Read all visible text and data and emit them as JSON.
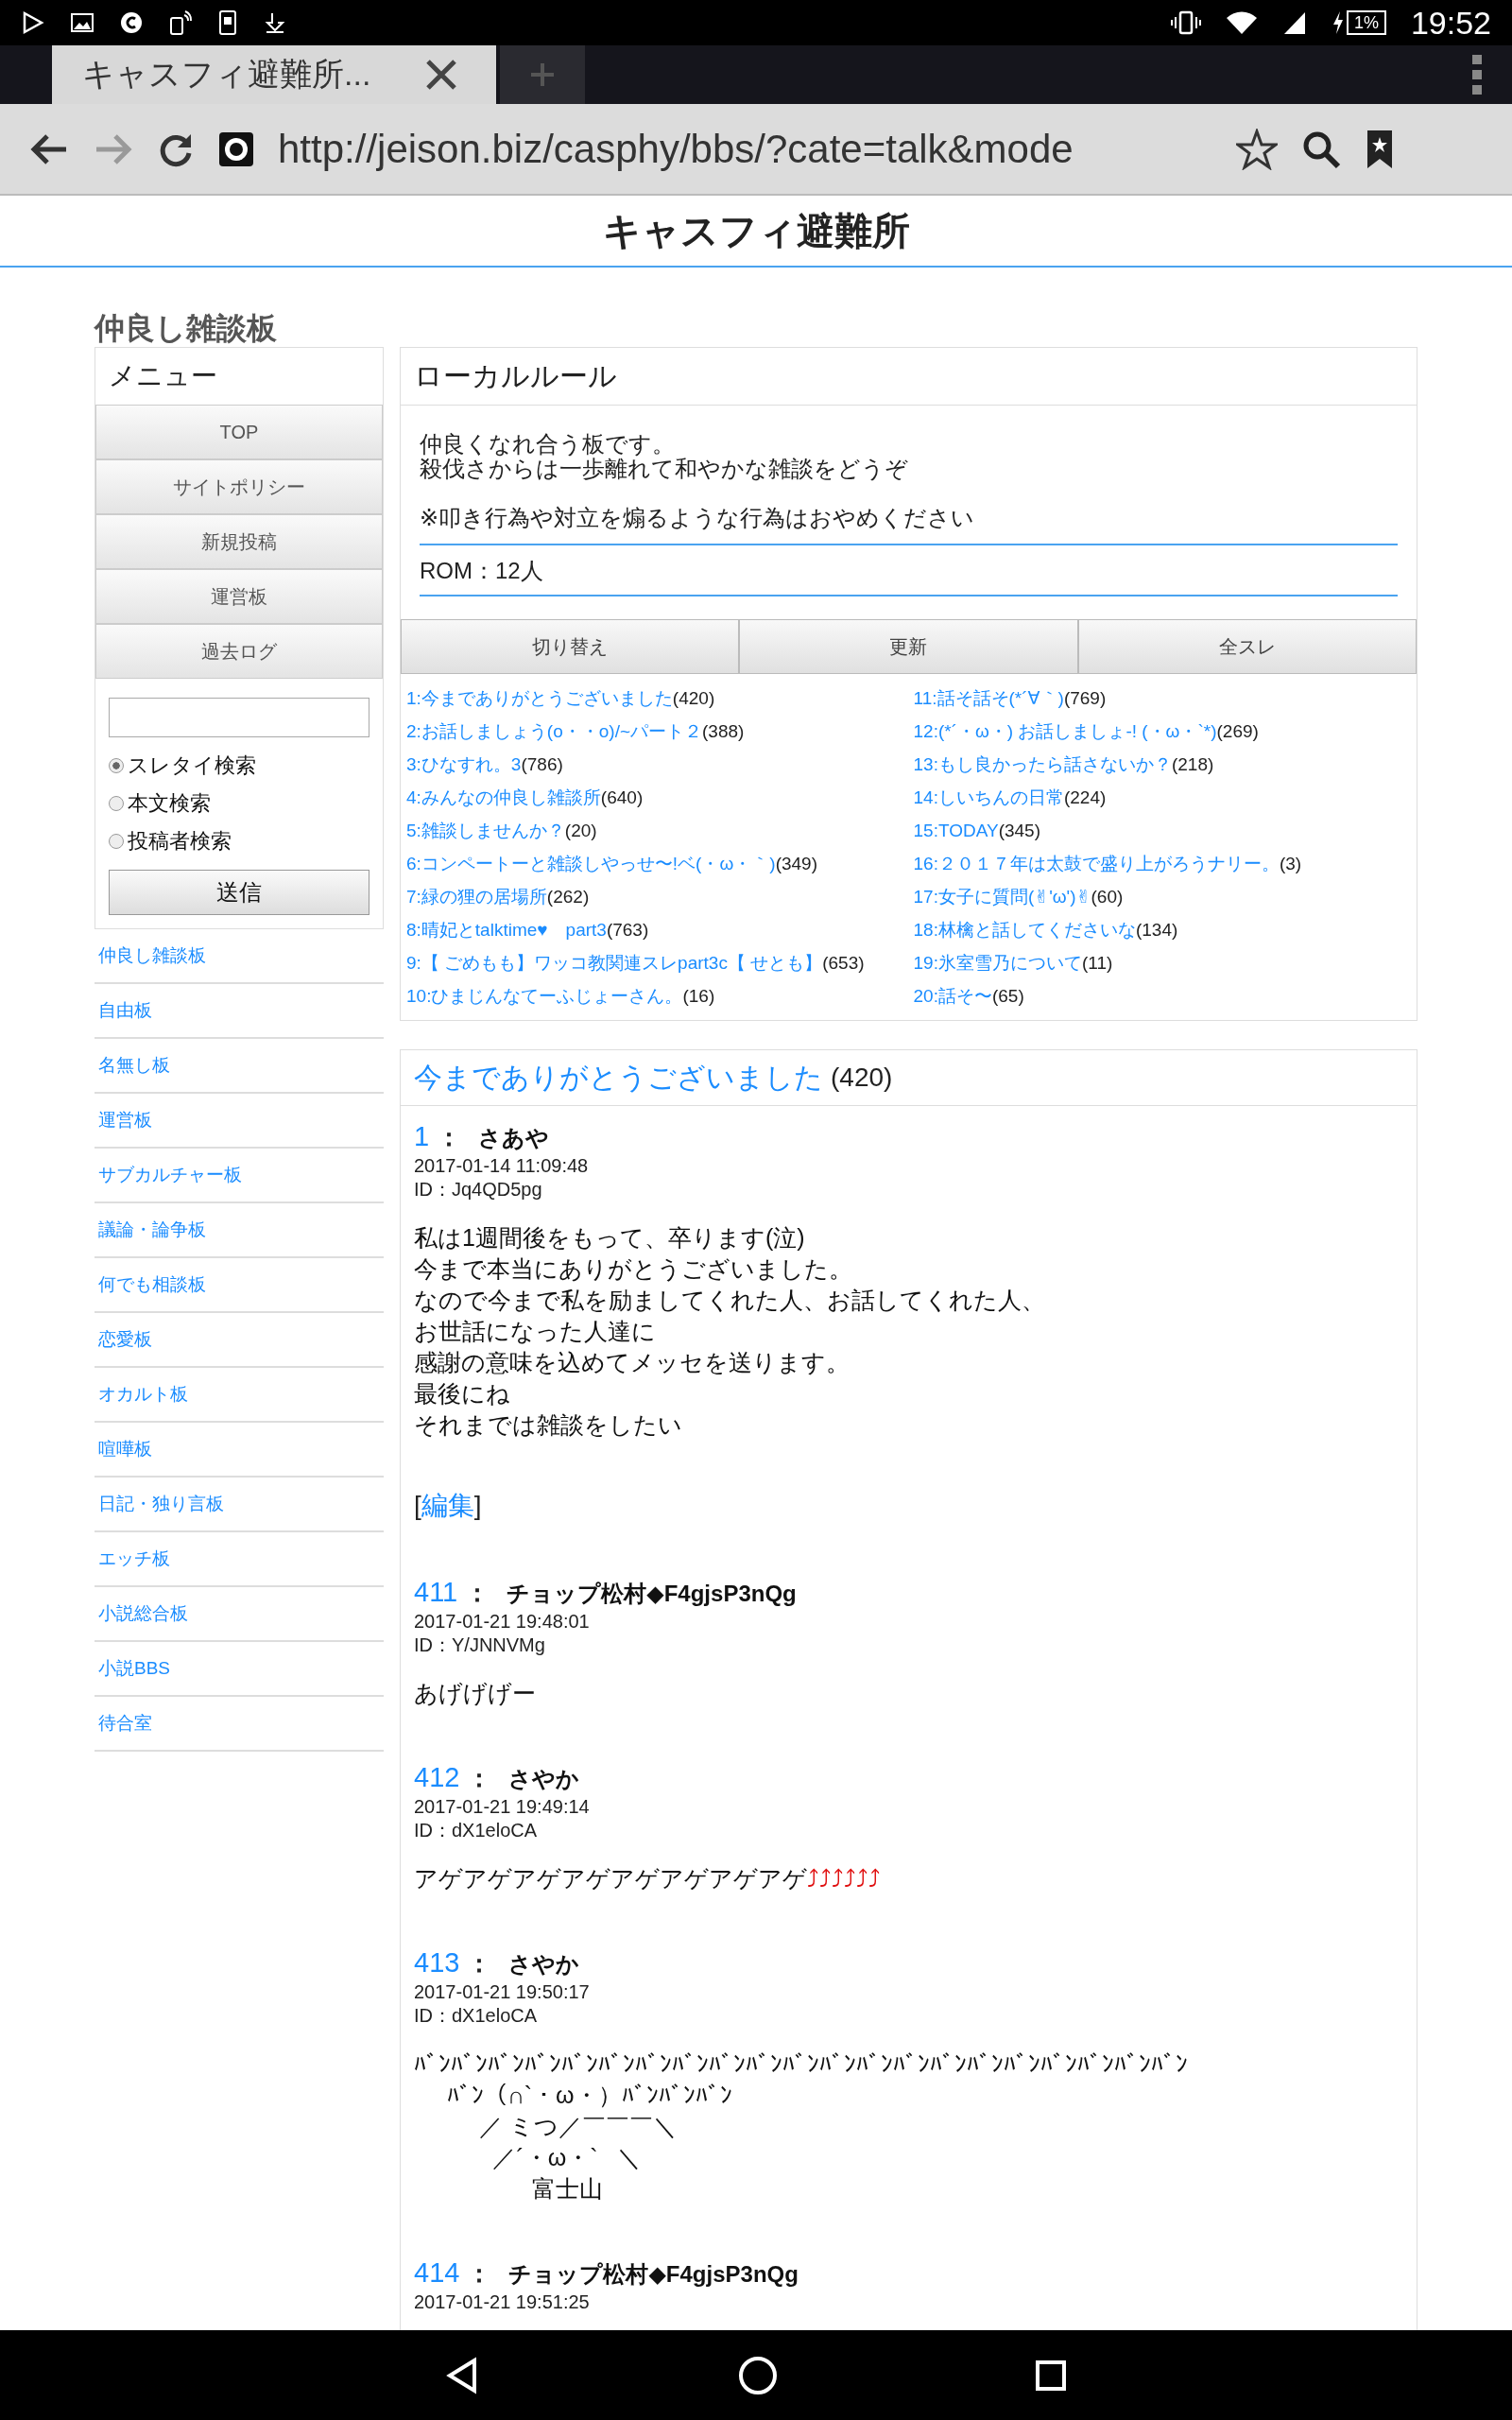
{
  "status_bar": {
    "time": "19:52",
    "battery": "1%"
  },
  "browser": {
    "tab_title": "キャスフィ避難所...",
    "url": "http://jeison.biz/casphy/bbs/?cate=talk&mode"
  },
  "site_title": "キャスフィ避難所",
  "board_title": "仲良し雑談板",
  "sidebar": {
    "menu_title": "メニュー",
    "menu_items": [
      "TOP",
      "サイトポリシー",
      "新規投稿",
      "運営板",
      "過去ログ"
    ],
    "search_options": [
      {
        "label": "スレタイ検索",
        "selected": true
      },
      {
        "label": "本文検索",
        "selected": false
      },
      {
        "label": "投稿者検索",
        "selected": false
      }
    ],
    "submit": "送信",
    "links": [
      "仲良し雑談板",
      "自由板",
      "名無し板",
      "運営板",
      "サブカルチャー板",
      "議論・論争板",
      "何でも相談板",
      "恋愛板",
      "オカルト板",
      "喧嘩板",
      "日記・独り言板",
      "エッチ板",
      "小説総合板",
      "小説BBS",
      "待合室"
    ]
  },
  "local_rules": {
    "title": "ローカルルール",
    "lines": [
      "仲良くなれ合う板です。",
      "殺伐さからは一歩離れて和やかな雑談をどうぞ"
    ],
    "note": "※叩き行為や対立を煽るような行為はおやめください",
    "rom": "ROM：12人"
  },
  "thread_buttons": [
    "切り替え",
    "更新",
    "全スレ"
  ],
  "thread_columns": [
    [
      {
        "title": "1:今までありがとうございました",
        "count": "(420)"
      },
      {
        "title": "2:お話しましょう(o・・o)/~パート２",
        "count": "(388)"
      },
      {
        "title": "3:ひなすれ。3",
        "count": "(786)"
      },
      {
        "title": "4:みんなの仲良し雑談所",
        "count": "(640)"
      },
      {
        "title": "5:雑談しませんか？",
        "count": "(20)"
      },
      {
        "title": "6:コンペートーと雑談しやっせ〜!ベ(・ω・｀)",
        "count": "(349)"
      },
      {
        "title": "7:緑の狸の居場所",
        "count": "(262)"
      },
      {
        "title": "8:晴妃とtalktime♥　part3",
        "count": "(763)"
      },
      {
        "title": "9:【 ごめもも】ワッコ教関連スレpart3c【 せとも】",
        "count": "(653)"
      },
      {
        "title": "10:ひまじんなてーふじょーさん。",
        "count": "(16)"
      }
    ],
    [
      {
        "title": "11:話そ話そ(*´∀｀)",
        "count": "(769)"
      },
      {
        "title": "12:(*´・ω・) お話しましょ-! (・ω・`*)",
        "count": "(269)"
      },
      {
        "title": "13:もし良かったら話さないか？",
        "count": "(218)"
      },
      {
        "title": "14:しいちんの日常",
        "count": "(224)"
      },
      {
        "title": "15:TODAY",
        "count": "(345)"
      },
      {
        "title": "16:２０１７年は太鼓で盛り上がろうナリー。",
        "count": "(3)"
      },
      {
        "title": "17:女子に質問(✌'ω')✌",
        "count": "(60)"
      },
      {
        "title": "18:林檎と話してくださいな",
        "count": "(134)"
      },
      {
        "title": "19:氷室雪乃について",
        "count": "(11)"
      },
      {
        "title": "20:話そ〜",
        "count": "(65)"
      }
    ]
  ],
  "thread": {
    "title": "今までありがとうございました",
    "count": "(420)",
    "posts": [
      {
        "number": "1",
        "colon": "：",
        "name": "さあや",
        "date": "2017-01-14 11:09:48",
        "id": "ID：Jq4QD5pg",
        "body": [
          {
            "text": "私は1週間後をもって、卒ります(泣)"
          },
          {
            "text": "今まで本当にありがとうございました。"
          },
          {
            "text": "なので今まで私を励ましてくれた人、お話してくれた人、"
          },
          {
            "text": "お世話になった人達に"
          },
          {
            "text": "感謝の意味を込めてメッセを送ります。"
          },
          {
            "text": "最後にね"
          },
          {
            "text": "それまでは雑談をしたい"
          }
        ],
        "edit": {
          "open": "[",
          "label": "編集",
          "close": "]"
        }
      },
      {
        "number": "411",
        "colon": "：",
        "name": "チョップ松村◆F4gjsP3nQg",
        "date": "2017-01-21 19:48:01",
        "id": "ID：Y/JNNVMg",
        "body": [
          {
            "text": "あげげげー"
          }
        ]
      },
      {
        "number": "412",
        "colon": "：",
        "name": "さやか",
        "date": "2017-01-21 19:49:14",
        "id": "ID：dX1eloCA",
        "body": [
          {
            "text": "アゲアゲアゲアゲアゲアゲアゲアゲ",
            "emoji": "⤴⤴⤴⤴⤴⤴"
          }
        ]
      },
      {
        "number": "413",
        "colon": "：",
        "name": "さやか",
        "date": "2017-01-21 19:50:17",
        "id": "ID：dX1eloCA",
        "body": [
          {
            "text": "ﾊﾞﾝﾊﾞﾝﾊﾞﾝﾊﾞﾝﾊﾞﾝﾊﾞﾝﾊﾞﾝﾊﾞﾝﾊﾞﾝﾊﾞﾝﾊﾞﾝﾊﾞﾝﾊﾞﾝﾊﾞﾝﾊﾞﾝﾊﾞﾝﾊﾞﾝﾊﾞﾝﾊﾞﾝﾊﾞﾝﾊﾞﾝ"
          },
          {
            "text": "     ﾊﾞﾝ（∩`・ω・）ﾊﾞﾝﾊﾞﾝﾊﾞﾝ"
          },
          {
            "text": "          ／ ミつ／￣￣￣＼"
          },
          {
            "text": "            ／´・ω・`   ＼"
          },
          {
            "text": "                  富士山"
          }
        ]
      },
      {
        "number": "414",
        "colon": "：",
        "name": "チョップ松村◆F4gjsP3nQg",
        "date": "2017-01-21 19:51:25"
      }
    ]
  }
}
